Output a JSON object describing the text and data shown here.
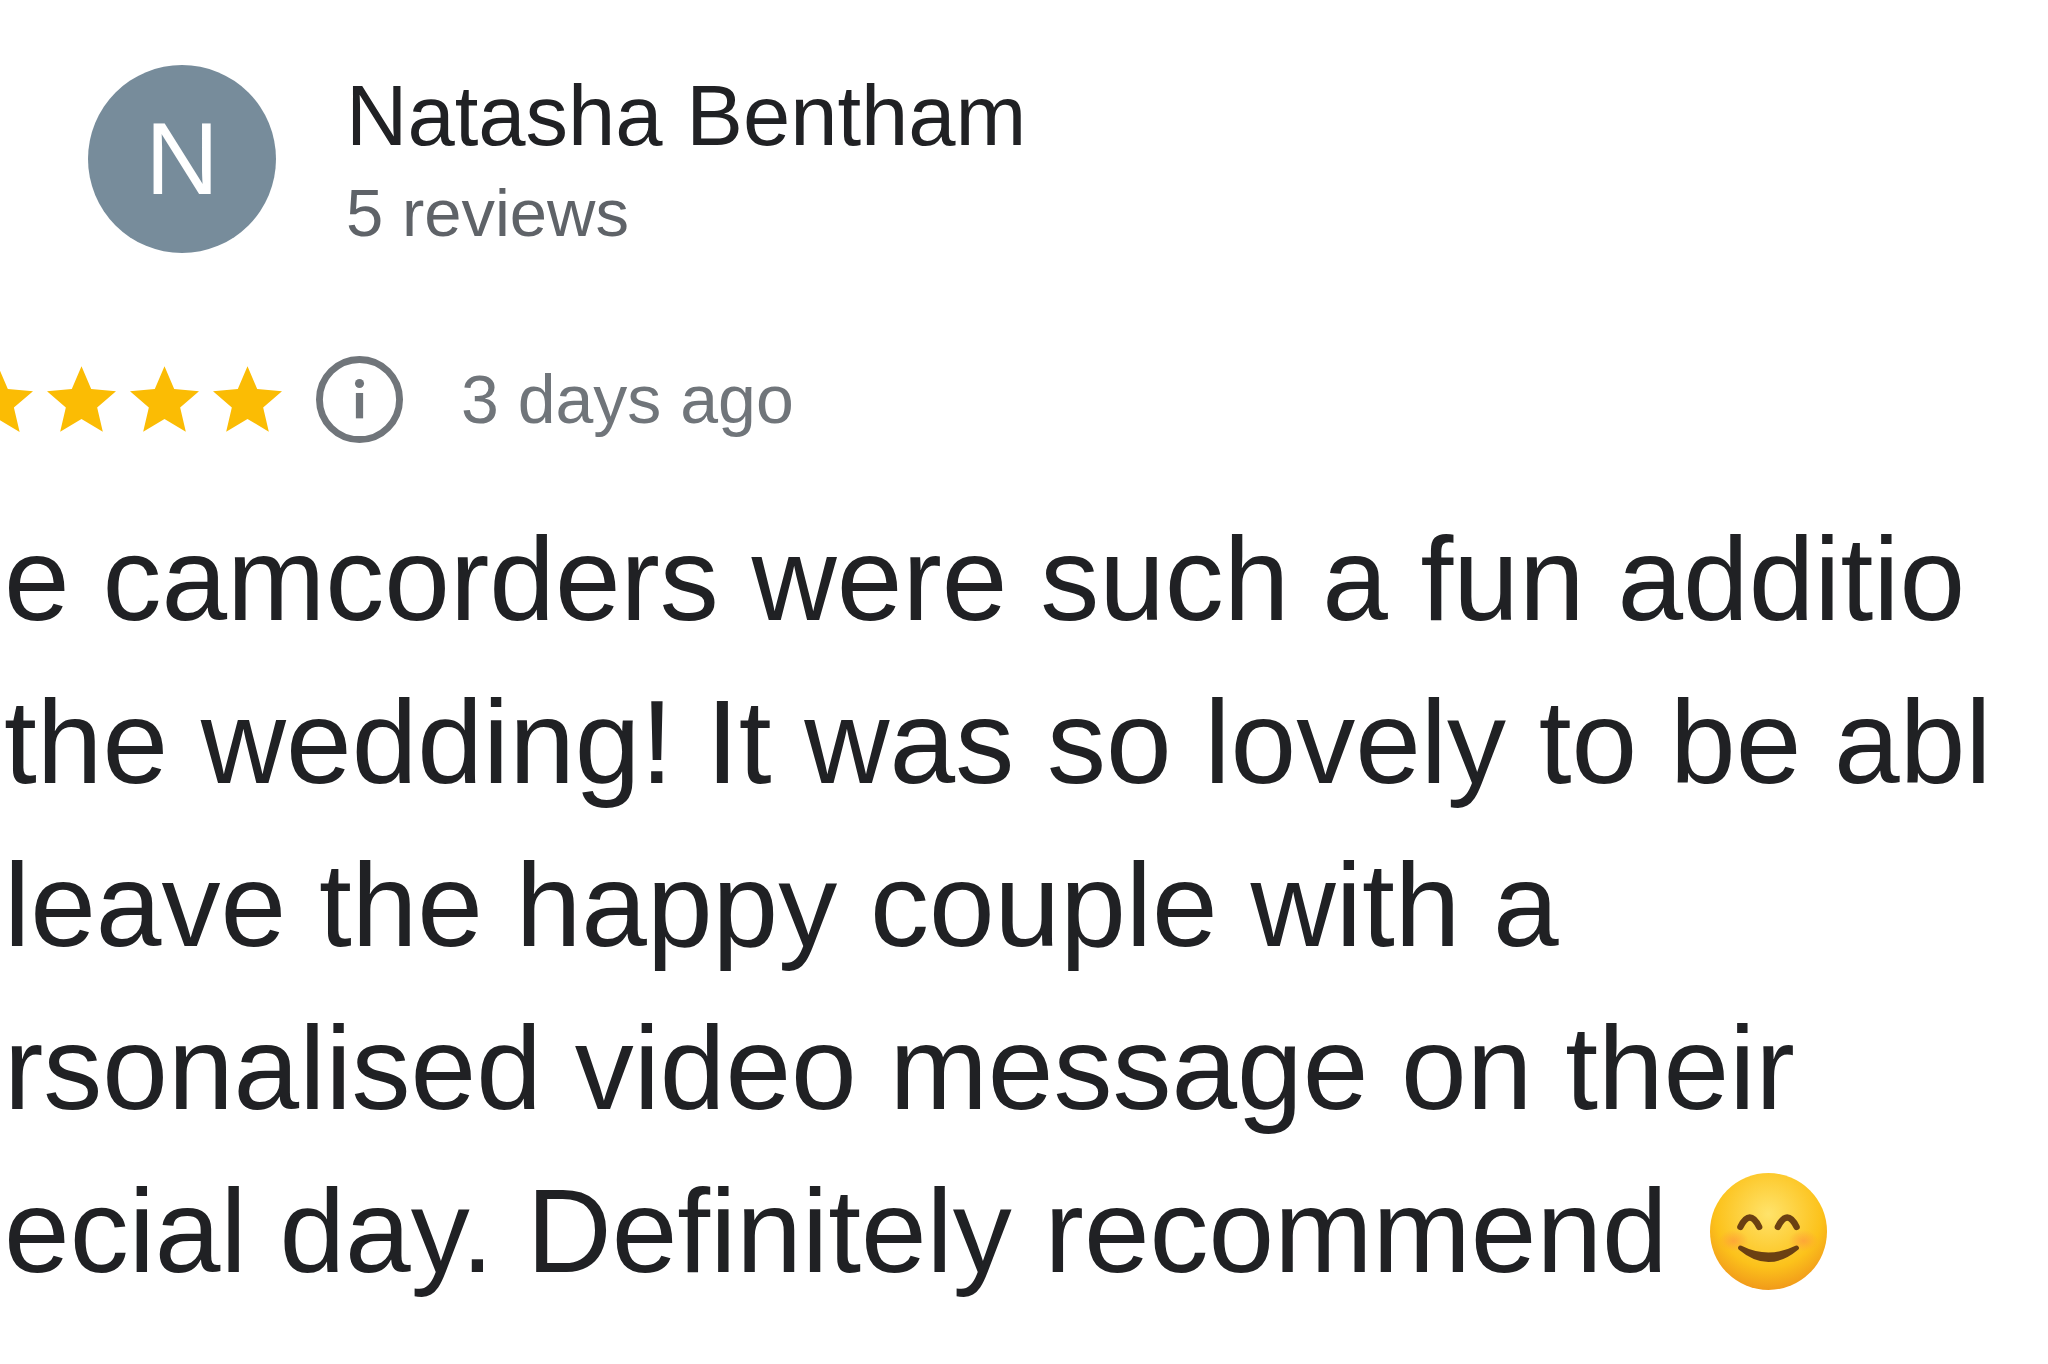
{
  "reviewer": {
    "avatar_letter": "N",
    "name": "Natasha Bentham",
    "review_count": "5 reviews"
  },
  "rating": {
    "stars": 4,
    "date": "3 days ago"
  },
  "review_text_lines": [
    "e camcorders were such a fun additio",
    "the wedding! It was so lovely to be abl",
    "leave the happy couple with a",
    "rsonalised video message on their",
    "ecial day. Definitely recommend"
  ]
}
